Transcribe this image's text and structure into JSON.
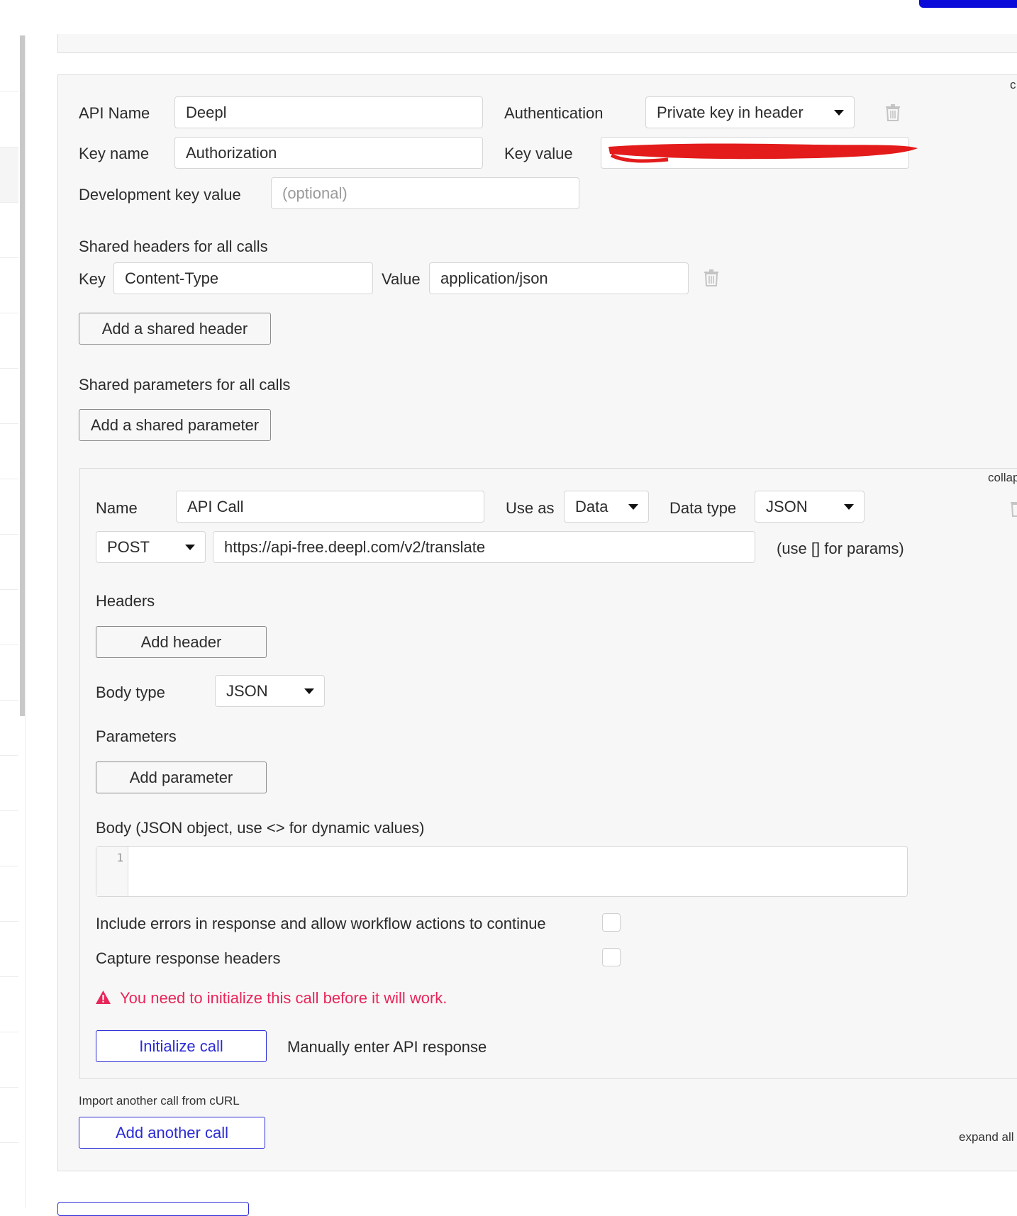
{
  "api": {
    "name_label": "API Name",
    "name_value": "Deepl",
    "auth_label": "Authentication",
    "auth_value": "Private key in header",
    "key_name_label": "Key name",
    "key_name_value": "Authorization",
    "key_value_label": "Key value",
    "dev_key_label": "Development key value",
    "dev_key_placeholder": "(optional)",
    "collapse_link_partial": "c"
  },
  "shared_headers": {
    "title": "Shared headers for all calls",
    "key_label": "Key",
    "key_value": "Content-Type",
    "value_label": "Value",
    "value_value": "application/json",
    "add_button": "Add a shared header"
  },
  "shared_params": {
    "title": "Shared parameters for all calls",
    "add_button": "Add a shared parameter"
  },
  "call": {
    "collapse_link": "collap",
    "name_label": "Name",
    "name_value": "API Call",
    "use_as_label": "Use as",
    "use_as_value": "Data",
    "data_type_label": "Data type",
    "data_type_value": "JSON",
    "method": "POST",
    "url": "https://api-free.deepl.com/v2/translate",
    "url_hint": "(use [] for params)",
    "headers_label": "Headers",
    "add_header_button": "Add header",
    "body_type_label": "Body type",
    "body_type_value": "JSON",
    "parameters_label": "Parameters",
    "add_parameter_button": "Add parameter",
    "body_label": "Body (JSON object, use <> for dynamic values)",
    "body_line_number": "1",
    "include_errors_label": "Include errors in response and allow workflow actions to continue",
    "capture_headers_label": "Capture response headers",
    "warning_text": "You need to initialize this call before it will work.",
    "initialize_button": "Initialize call",
    "manual_response_link": "Manually enter API response"
  },
  "footer": {
    "import_link": "Import another call from cURL",
    "add_call_button": "Add another call",
    "expand_all": "expand all"
  },
  "colors": {
    "accent_blue": "#2b2bd6",
    "top_button_blue": "#0b0bd9",
    "warning_red": "#e8265a",
    "redaction_red": "#e31b1b",
    "panel_bg": "#f7f7f7"
  }
}
